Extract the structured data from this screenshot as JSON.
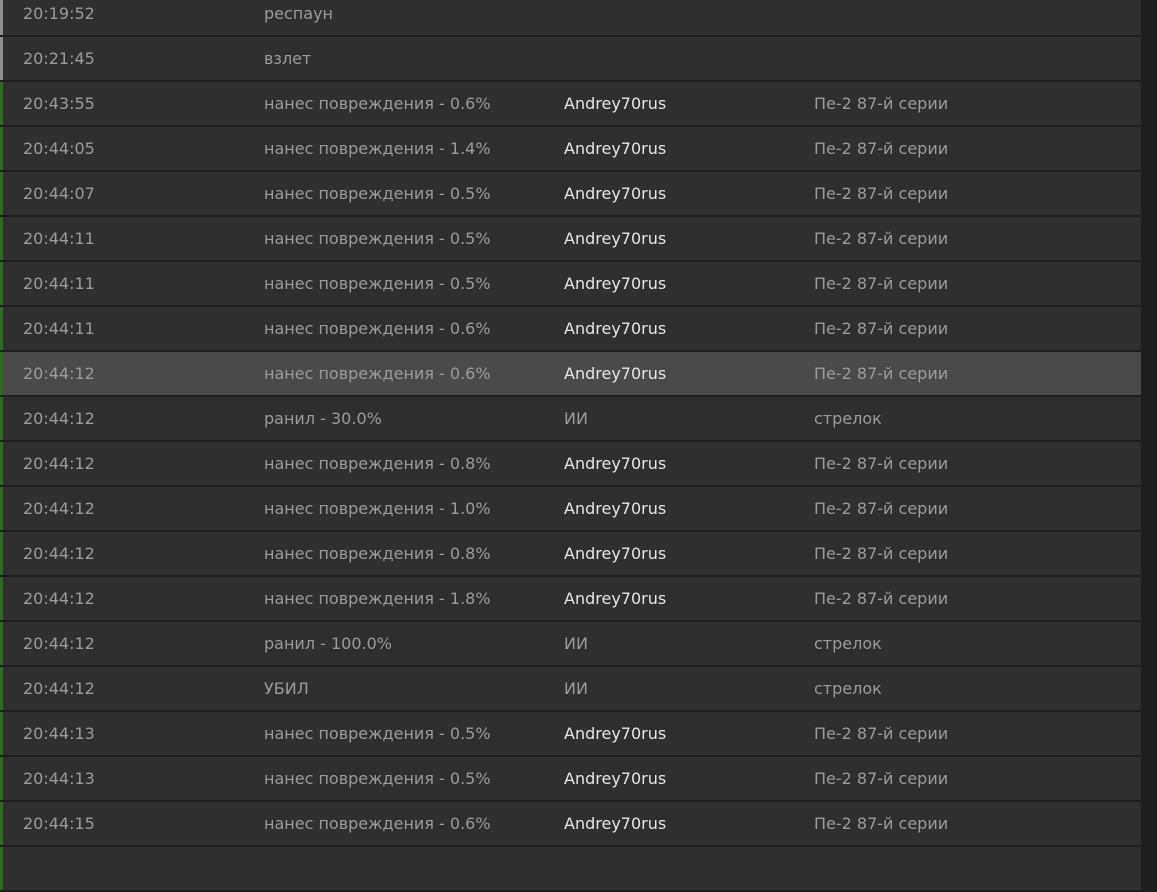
{
  "colors": {
    "background": "#1e1e1e",
    "row": "#2f2f2f",
    "row_selected": "#4a4a4a",
    "accent_green": "#2e6b22",
    "accent_gray": "#8d8d8d"
  },
  "rows": [
    {
      "time": "20:19:52",
      "event": "респаун",
      "player": "",
      "target": "",
      "kind": "neutral"
    },
    {
      "time": "20:21:45",
      "event": "взлет",
      "player": "",
      "target": "",
      "kind": "neutral"
    },
    {
      "time": "20:43:55",
      "event": "нанес повреждения - 0.6%",
      "player": "Andrey70rus",
      "target": "Пе-2 87-й серии",
      "kind": "combat"
    },
    {
      "time": "20:44:05",
      "event": "нанес повреждения - 1.4%",
      "player": "Andrey70rus",
      "target": "Пе-2 87-й серии",
      "kind": "combat"
    },
    {
      "time": "20:44:07",
      "event": "нанес повреждения - 0.5%",
      "player": "Andrey70rus",
      "target": "Пе-2 87-й серии",
      "kind": "combat"
    },
    {
      "time": "20:44:11",
      "event": "нанес повреждения - 0.5%",
      "player": "Andrey70rus",
      "target": "Пе-2 87-й серии",
      "kind": "combat"
    },
    {
      "time": "20:44:11",
      "event": "нанес повреждения - 0.5%",
      "player": "Andrey70rus",
      "target": "Пе-2 87-й серии",
      "kind": "combat"
    },
    {
      "time": "20:44:11",
      "event": "нанес повреждения - 0.6%",
      "player": "Andrey70rus",
      "target": "Пе-2 87-й серии",
      "kind": "combat"
    },
    {
      "time": "20:44:12",
      "event": "нанес повреждения - 0.6%",
      "player": "Andrey70rus",
      "target": "Пе-2 87-й серии",
      "kind": "combat",
      "selected": true
    },
    {
      "time": "20:44:12",
      "event": "ранил - 30.0%",
      "player": "ИИ",
      "target": "стрелок",
      "kind": "combat",
      "ai": true
    },
    {
      "time": "20:44:12",
      "event": "нанес повреждения - 0.8%",
      "player": "Andrey70rus",
      "target": "Пе-2 87-й серии",
      "kind": "combat"
    },
    {
      "time": "20:44:12",
      "event": "нанес повреждения - 1.0%",
      "player": "Andrey70rus",
      "target": "Пе-2 87-й серии",
      "kind": "combat"
    },
    {
      "time": "20:44:12",
      "event": "нанес повреждения - 0.8%",
      "player": "Andrey70rus",
      "target": "Пе-2 87-й серии",
      "kind": "combat"
    },
    {
      "time": "20:44:12",
      "event": "нанес повреждения - 1.8%",
      "player": "Andrey70rus",
      "target": "Пе-2 87-й серии",
      "kind": "combat"
    },
    {
      "time": "20:44:12",
      "event": "ранил - 100.0%",
      "player": "ИИ",
      "target": "стрелок",
      "kind": "combat",
      "ai": true
    },
    {
      "time": "20:44:12",
      "event": "УБИЛ",
      "player": "ИИ",
      "target": "стрелок",
      "kind": "combat",
      "ai": true
    },
    {
      "time": "20:44:13",
      "event": "нанес повреждения - 0.5%",
      "player": "Andrey70rus",
      "target": "Пе-2 87-й серии",
      "kind": "combat"
    },
    {
      "time": "20:44:13",
      "event": "нанес повреждения - 0.5%",
      "player": "Andrey70rus",
      "target": "Пе-2 87-й серии",
      "kind": "combat"
    },
    {
      "time": "20:44:15",
      "event": "нанес повреждения - 0.6%",
      "player": "Andrey70rus",
      "target": "Пе-2 87-й серии",
      "kind": "combat"
    },
    {
      "time": "",
      "event": "",
      "player": "",
      "target": "",
      "kind": "combat"
    }
  ]
}
